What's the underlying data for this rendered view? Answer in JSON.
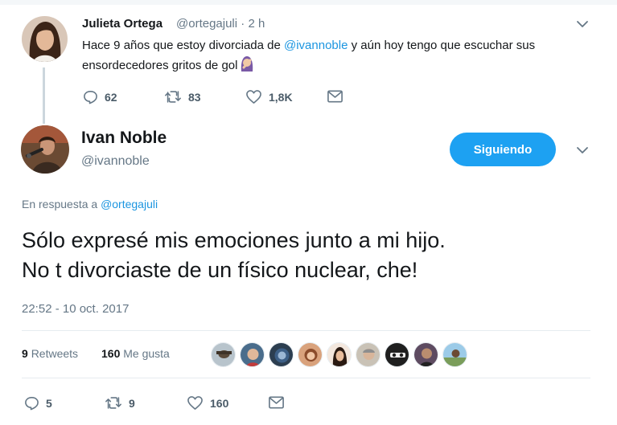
{
  "parent_tweet": {
    "name": "Julieta Ortega",
    "handle": "@ortegajuli",
    "time": "· 2 h",
    "text_before": "Hace 9 años que estoy divorciada de ",
    "mention": "@ivannoble",
    "text_after": " y aún hoy tengo que escuchar sus ensordecedores gritos de gol",
    "emoji": "woman-facepalming-emoji",
    "actions": {
      "replies": "62",
      "retweets": "83",
      "likes": "1,8K"
    }
  },
  "main_tweet": {
    "name": "Ivan Noble",
    "handle": "@ivannoble",
    "follow_button": "Siguiendo",
    "reply_prefix": "En respuesta a ",
    "reply_to": "@ortegajuli",
    "text_line1": "Sólo expresé mis emociones junto a mi hijo.",
    "text_line2": "No t divorciaste de un físico nuclear, che!",
    "timestamp": "22:52 - 10 oct. 2017",
    "retweets_count": "9",
    "retweets_label": "Retweets",
    "likes_count": "160",
    "likes_label": "Me gusta",
    "actions": {
      "replies": "5",
      "retweets": "9",
      "likes": "160"
    }
  },
  "likers": [
    "liker-avatar-1",
    "liker-avatar-2",
    "liker-avatar-3",
    "liker-avatar-4",
    "liker-avatar-5",
    "liker-avatar-6",
    "liker-avatar-7",
    "liker-avatar-8",
    "liker-avatar-9"
  ],
  "colors": {
    "accent": "#1da1f2",
    "link": "#1b95e0",
    "muted": "#657786",
    "text": "#14171a"
  }
}
